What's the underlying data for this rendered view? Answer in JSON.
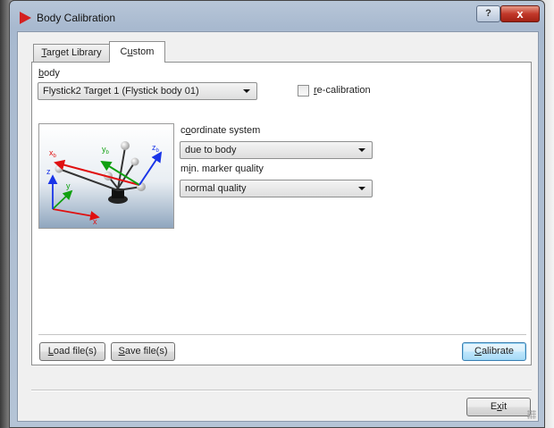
{
  "window": {
    "title": "Body Calibration",
    "help_glyph": "?",
    "close_glyph": "x"
  },
  "tabs": {
    "library_label": "Target Library",
    "library_mnemonic": "T",
    "library_rest": "arget Library",
    "custom_label": "Custom",
    "custom_pre": "C",
    "custom_mnemonic": "u",
    "custom_post": "stom",
    "active": "Custom"
  },
  "body_section": {
    "label": "body",
    "label_mnemonic": "b",
    "label_rest": "ody",
    "selected_value": "Flystick2 Target 1 (Flystick body 01)",
    "recalibration_label": "re-calibration",
    "recalibration_mnemonic": "r",
    "recalibration_rest": "e-calibration",
    "recalibration_checked": false
  },
  "illustration": {
    "axis_xb": "x",
    "axis_xb_sub": "b",
    "axis_yb": "y",
    "axis_yb_sub": "b",
    "axis_zb": "z",
    "axis_zb_sub": "b",
    "axis_x": "x",
    "axis_y": "y",
    "axis_z": "z",
    "colors": {
      "x": "#e01010",
      "y": "#10a010",
      "z": "#1a35e8"
    }
  },
  "coordinate_system": {
    "label": "coordinate system",
    "label_pre": "c",
    "label_mnemonic": "o",
    "label_post": "ordinate system",
    "selected_value": "due to body"
  },
  "marker_quality": {
    "label": "min. marker quality",
    "label_pre": "m",
    "label_mnemonic": "i",
    "label_post": "n. marker quality",
    "selected_value": "normal quality"
  },
  "buttons": {
    "load_label": "Load file(s)",
    "load_mnemonic": "L",
    "load_rest": "oad file(s)",
    "save_label": "Save file(s)",
    "save_mnemonic": "S",
    "save_rest": "ave file(s)",
    "calibrate_label": "Calibrate",
    "calibrate_mnemonic": "C",
    "calibrate_rest": "alibrate",
    "exit_label": "Exit",
    "exit_pre": "E",
    "exit_mnemonic": "x",
    "exit_post": "it"
  }
}
